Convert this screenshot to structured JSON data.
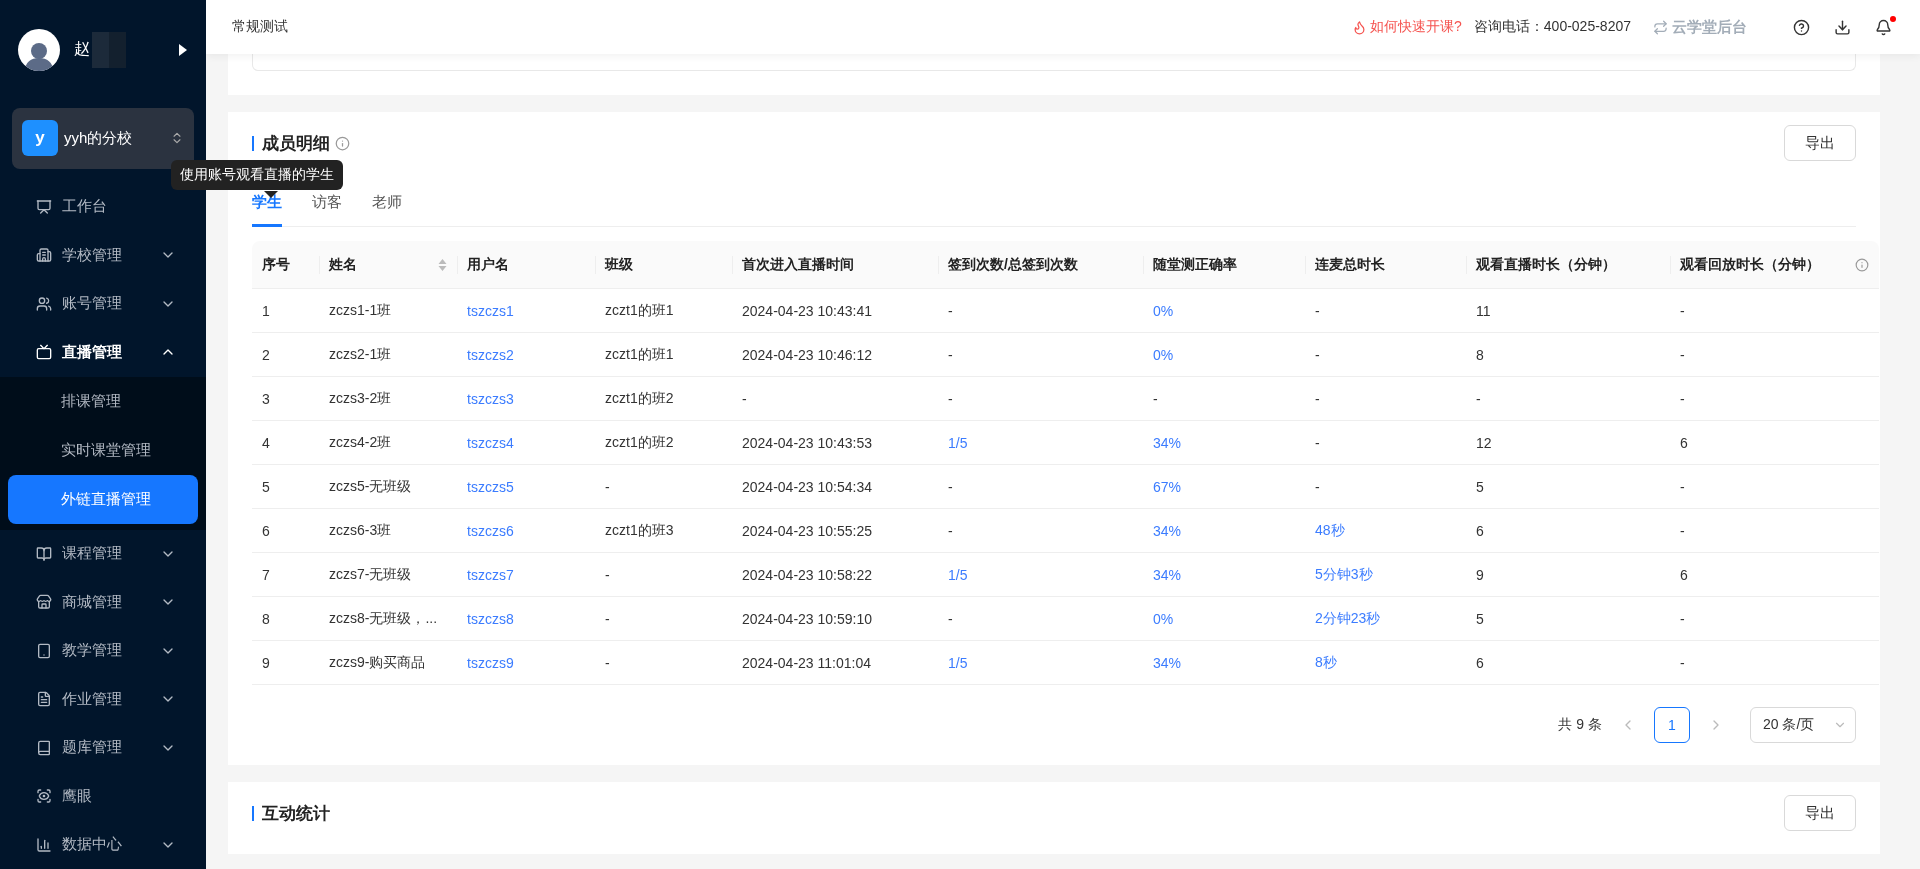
{
  "sidebar": {
    "user": {
      "name": "赵"
    },
    "school": {
      "badge": "y",
      "name": "yyh的分校"
    },
    "items": [
      {
        "label": "工作台",
        "kind": "desk",
        "selected": false
      },
      {
        "label": "学校管理",
        "kind": "school",
        "expandable": true,
        "expanded": false,
        "selected": false
      },
      {
        "label": "账号管理",
        "kind": "account",
        "expandable": true,
        "expanded": false,
        "selected": false
      },
      {
        "label": "直播管理",
        "kind": "live",
        "expandable": true,
        "expanded": true,
        "selected": true,
        "children": [
          {
            "label": "排课管理",
            "selected": false
          },
          {
            "label": "实时课堂管理",
            "selected": false
          },
          {
            "label": "外链直播管理",
            "selected": true
          }
        ]
      },
      {
        "label": "课程管理",
        "kind": "course",
        "expandable": true,
        "expanded": false,
        "selected": false
      },
      {
        "label": "商城管理",
        "kind": "shop",
        "expandable": true,
        "expanded": false,
        "selected": false
      },
      {
        "label": "教学管理",
        "kind": "teach",
        "expandable": true,
        "expanded": false,
        "selected": false
      },
      {
        "label": "作业管理",
        "kind": "homework",
        "expandable": true,
        "expanded": false,
        "selected": false
      },
      {
        "label": "题库管理",
        "kind": "bank",
        "expandable": true,
        "expanded": false,
        "selected": false
      },
      {
        "label": "鹰眼",
        "kind": "eye",
        "expandable": false,
        "selected": false
      },
      {
        "label": "数据中心",
        "kind": "data",
        "expandable": true,
        "expanded": false,
        "selected": false
      }
    ]
  },
  "header": {
    "title": "常规测试",
    "help_link": "如何快速开课?",
    "phone_label": "咨询电话：",
    "phone": "400-025-8207",
    "backend": "云学堂后台",
    "has_notification": true
  },
  "members": {
    "title": "成员明细",
    "tooltip": "使用账号观看直播的学生",
    "export": "导出",
    "tabs": [
      {
        "label": "学生",
        "selected": true
      },
      {
        "label": "访客",
        "selected": false
      },
      {
        "label": "老师",
        "selected": false
      }
    ],
    "columns": [
      {
        "label": "序号"
      },
      {
        "label": "姓名",
        "sortable": true
      },
      {
        "label": "用户名"
      },
      {
        "label": "班级"
      },
      {
        "label": "首次进入直播时间"
      },
      {
        "label": "签到次数/总签到次数"
      },
      {
        "label": "随堂测正确率"
      },
      {
        "label": "连麦总时长"
      },
      {
        "label": "观看直播时长（分钟）"
      },
      {
        "label": "观看回放时长（分钟）",
        "info": true
      }
    ],
    "rows": [
      {
        "cells": [
          {
            "text": "1",
            "link": false
          },
          {
            "text": "zczs1-1班",
            "link": false
          },
          {
            "text": "tszczs1",
            "link": true
          },
          {
            "text": "zczt1的班1",
            "link": false
          },
          {
            "text": "2024-04-23 10:43:41",
            "link": false
          },
          {
            "text": "-",
            "link": false
          },
          {
            "text": "0%",
            "link": true
          },
          {
            "text": "-",
            "link": false
          },
          {
            "text": "11",
            "link": false
          },
          {
            "text": "-",
            "link": false
          }
        ]
      },
      {
        "cells": [
          {
            "text": "2",
            "link": false
          },
          {
            "text": "zczs2-1班",
            "link": false
          },
          {
            "text": "tszczs2",
            "link": true
          },
          {
            "text": "zczt1的班1",
            "link": false
          },
          {
            "text": "2024-04-23 10:46:12",
            "link": false
          },
          {
            "text": "-",
            "link": false
          },
          {
            "text": "0%",
            "link": true
          },
          {
            "text": "-",
            "link": false
          },
          {
            "text": "8",
            "link": false
          },
          {
            "text": "-",
            "link": false
          }
        ]
      },
      {
        "cells": [
          {
            "text": "3",
            "link": false
          },
          {
            "text": "zczs3-2班",
            "link": false
          },
          {
            "text": "tszczs3",
            "link": true
          },
          {
            "text": "zczt1的班2",
            "link": false
          },
          {
            "text": "-",
            "link": false
          },
          {
            "text": "-",
            "link": false
          },
          {
            "text": "-",
            "link": false
          },
          {
            "text": "-",
            "link": false
          },
          {
            "text": "-",
            "link": false
          },
          {
            "text": "-",
            "link": false
          }
        ]
      },
      {
        "cells": [
          {
            "text": "4",
            "link": false
          },
          {
            "text": "zczs4-2班",
            "link": false
          },
          {
            "text": "tszczs4",
            "link": true
          },
          {
            "text": "zczt1的班2",
            "link": false
          },
          {
            "text": "2024-04-23 10:43:53",
            "link": false
          },
          {
            "text": "1/5",
            "link": true
          },
          {
            "text": "34%",
            "link": true
          },
          {
            "text": "-",
            "link": false
          },
          {
            "text": "12",
            "link": false
          },
          {
            "text": "6",
            "link": false
          }
        ]
      },
      {
        "cells": [
          {
            "text": "5",
            "link": false
          },
          {
            "text": "zczs5-无班级",
            "link": false
          },
          {
            "text": "tszczs5",
            "link": true
          },
          {
            "text": "-",
            "link": false
          },
          {
            "text": "2024-04-23 10:54:34",
            "link": false
          },
          {
            "text": "-",
            "link": false
          },
          {
            "text": "67%",
            "link": true
          },
          {
            "text": "-",
            "link": false
          },
          {
            "text": "5",
            "link": false
          },
          {
            "text": "-",
            "link": false
          }
        ]
      },
      {
        "cells": [
          {
            "text": "6",
            "link": false
          },
          {
            "text": "zczs6-3班",
            "link": false
          },
          {
            "text": "tszczs6",
            "link": true
          },
          {
            "text": "zczt1的班3",
            "link": false
          },
          {
            "text": "2024-04-23 10:55:25",
            "link": false
          },
          {
            "text": "-",
            "link": false
          },
          {
            "text": "34%",
            "link": true
          },
          {
            "text": "48秒",
            "link": true
          },
          {
            "text": "6",
            "link": false
          },
          {
            "text": "-",
            "link": false
          }
        ]
      },
      {
        "cells": [
          {
            "text": "7",
            "link": false
          },
          {
            "text": "zczs7-无班级",
            "link": false
          },
          {
            "text": "tszczs7",
            "link": true
          },
          {
            "text": "-",
            "link": false
          },
          {
            "text": "2024-04-23 10:58:22",
            "link": false
          },
          {
            "text": "1/5",
            "link": true
          },
          {
            "text": "34%",
            "link": true
          },
          {
            "text": "5分钟3秒",
            "link": true
          },
          {
            "text": "9",
            "link": false
          },
          {
            "text": "6",
            "link": false
          }
        ]
      },
      {
        "cells": [
          {
            "text": "8",
            "link": false
          },
          {
            "text": "zczs8-无班级，...",
            "link": false
          },
          {
            "text": "tszczs8",
            "link": true
          },
          {
            "text": "-",
            "link": false
          },
          {
            "text": "2024-04-23 10:59:10",
            "link": false
          },
          {
            "text": "-",
            "link": false
          },
          {
            "text": "0%",
            "link": true
          },
          {
            "text": "2分钟23秒",
            "link": true
          },
          {
            "text": "5",
            "link": false
          },
          {
            "text": "-",
            "link": false
          }
        ]
      },
      {
        "cells": [
          {
            "text": "9",
            "link": false
          },
          {
            "text": "zczs9-购买商品",
            "link": false
          },
          {
            "text": "tszczs9",
            "link": true
          },
          {
            "text": "-",
            "link": false
          },
          {
            "text": "2024-04-23 11:01:04",
            "link": false
          },
          {
            "text": "1/5",
            "link": true
          },
          {
            "text": "34%",
            "link": true
          },
          {
            "text": "8秒",
            "link": true
          },
          {
            "text": "6",
            "link": false
          },
          {
            "text": "-",
            "link": false
          }
        ]
      }
    ],
    "pagination": {
      "total": "共 9 条",
      "pages": [
        {
          "label": "1",
          "selected": true
        }
      ],
      "page_size": "20 条/页"
    }
  },
  "interaction": {
    "title": "互动统计",
    "export": "导出"
  }
}
